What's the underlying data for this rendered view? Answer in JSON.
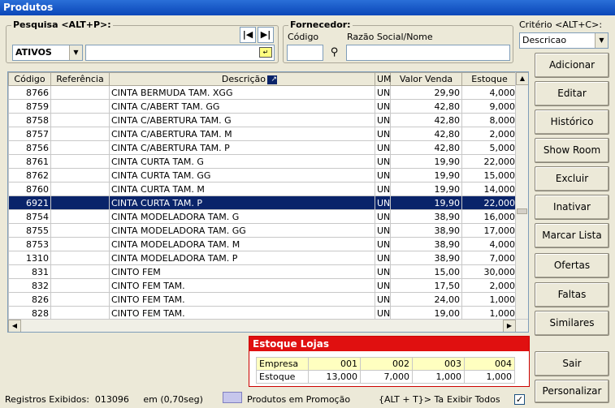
{
  "window": {
    "title": "Produtos"
  },
  "search": {
    "title": "Pesquisa <ALT+P>:",
    "status_value": "ATIVOS",
    "first_icon": "first-record-icon",
    "next_icon": "next-record-icon"
  },
  "supplier": {
    "title": "Fornecedor:",
    "code_label": "Código",
    "name_label": "Razão Social/Nome"
  },
  "criteria": {
    "label": "Critério <ALT+C>:",
    "value": "Descricao"
  },
  "grid": {
    "columns": [
      "Código",
      "Referência",
      "Descrição",
      "UM",
      "Valor Venda",
      "Estoque"
    ],
    "rows": [
      {
        "code": "8766",
        "ref": "",
        "desc": "CINTA BERMUDA TAM. XGG",
        "um": "UN",
        "price": "29,90",
        "stock": "4,000"
      },
      {
        "code": "8759",
        "ref": "",
        "desc": "CINTA C/ABERT TAM. GG",
        "um": "UN",
        "price": "42,80",
        "stock": "9,000"
      },
      {
        "code": "8758",
        "ref": "",
        "desc": "CINTA C/ABERTURA TAM. G",
        "um": "UN",
        "price": "42,80",
        "stock": "8,000"
      },
      {
        "code": "8757",
        "ref": "",
        "desc": "CINTA C/ABERTURA TAM. M",
        "um": "UN",
        "price": "42,80",
        "stock": "2,000"
      },
      {
        "code": "8756",
        "ref": "",
        "desc": "CINTA C/ABERTURA TAM. P",
        "um": "UN",
        "price": "42,80",
        "stock": "5,000"
      },
      {
        "code": "8761",
        "ref": "",
        "desc": "CINTA CURTA TAM. G",
        "um": "UN",
        "price": "19,90",
        "stock": "22,000"
      },
      {
        "code": "8762",
        "ref": "",
        "desc": "CINTA CURTA TAM. GG",
        "um": "UN",
        "price": "19,90",
        "stock": "15,000"
      },
      {
        "code": "8760",
        "ref": "",
        "desc": "CINTA CURTA TAM. M",
        "um": "UN",
        "price": "19,90",
        "stock": "14,000"
      },
      {
        "code": "6921",
        "ref": "",
        "desc": "CINTA CURTA TAM. P",
        "um": "UN",
        "price": "19,90",
        "stock": "22,000"
      },
      {
        "code": "8754",
        "ref": "",
        "desc": "CINTA MODELADORA TAM. G",
        "um": "UN",
        "price": "38,90",
        "stock": "16,000"
      },
      {
        "code": "8755",
        "ref": "",
        "desc": "CINTA MODELADORA TAM. GG",
        "um": "UN",
        "price": "38,90",
        "stock": "17,000"
      },
      {
        "code": "8753",
        "ref": "",
        "desc": "CINTA MODELADORA TAM. M",
        "um": "UN",
        "price": "38,90",
        "stock": "4,000"
      },
      {
        "code": "1310",
        "ref": "",
        "desc": "CINTA MODELADORA TAM. P",
        "um": "UN",
        "price": "38,90",
        "stock": "7,000"
      },
      {
        "code": "831",
        "ref": "",
        "desc": "CINTO FEM",
        "um": "UN",
        "price": "15,00",
        "stock": "30,000"
      },
      {
        "code": "832",
        "ref": "",
        "desc": "CINTO FEM  TAM.",
        "um": "UN",
        "price": "17,50",
        "stock": "2,000"
      },
      {
        "code": "826",
        "ref": "",
        "desc": "CINTO FEM  TAM.",
        "um": "UN",
        "price": "24,00",
        "stock": "1,000"
      },
      {
        "code": "828",
        "ref": "",
        "desc": "CINTO FEM  TAM.",
        "um": "UN",
        "price": "19,00",
        "stock": "1,000"
      }
    ]
  },
  "buttons": [
    "Adicionar",
    "Editar",
    "Histórico",
    "Show Room",
    "Excluir",
    "Inativar",
    "Marcar Lista",
    "Ofertas",
    "Faltas",
    "Similares"
  ],
  "exit_button": "Sair",
  "customize_button": "Personalizar",
  "stock": {
    "title": "Estoque Lojas",
    "company_label": "Empresa",
    "stock_label": "Estoque",
    "stores": [
      "001",
      "002",
      "003",
      "004"
    ],
    "values": [
      "13,000",
      "7,000",
      "1,000",
      "1,000"
    ]
  },
  "footer": {
    "records": "Registros Exibidos:  013096     em (0,70seg)",
    "promo_legend": "Produtos em Promoção",
    "shortcut": "{ALT + T}> Ta",
    "show_all": "Exibir Todos",
    "show_all_checked": "✓"
  }
}
